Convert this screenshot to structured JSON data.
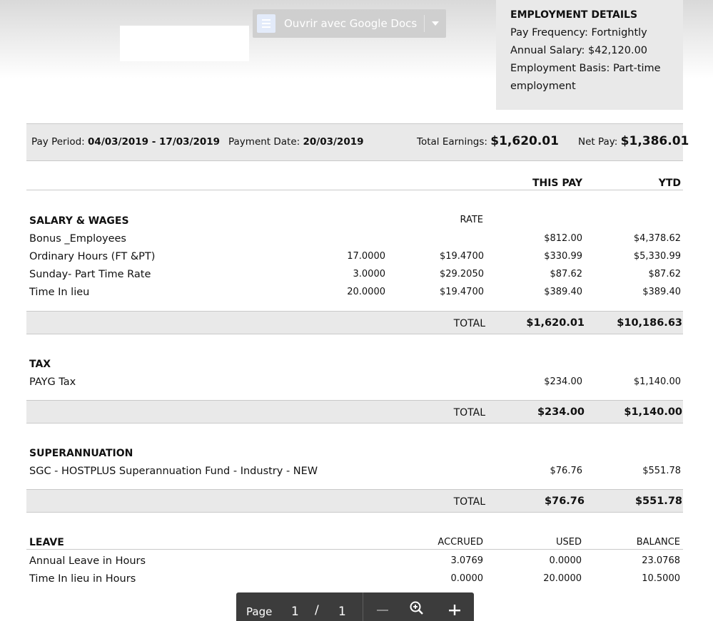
{
  "toolbar": {
    "open_with_label": "Ouvrir avec Google Docs"
  },
  "employment": {
    "heading": "EMPLOYMENT DETAILS",
    "pay_frequency": "Pay Frequency: Fortnightly",
    "annual_salary": "Annual Salary: $42,120.00",
    "basis_line1": "Employment Basis: Part-time",
    "basis_line2": "employment"
  },
  "summary": {
    "pay_period_label": "Pay Period: ",
    "pay_period_value": "04/03/2019 - 17/03/2019",
    "payment_date_label": "Payment Date: ",
    "payment_date_value": "20/03/2019",
    "total_earnings_label": "Total Earnings: ",
    "total_earnings_value": "$1,620.01",
    "net_pay_label": "Net Pay: ",
    "net_pay_value": "$1,386.01"
  },
  "columns": {
    "this_pay": "THIS PAY",
    "ytd": "YTD"
  },
  "salary": {
    "heading": "SALARY & WAGES",
    "rate_header": "RATE",
    "rows": [
      {
        "label": "Bonus _Employees",
        "hours": "",
        "rate": "",
        "this_pay": "$812.00",
        "ytd": "$4,378.62"
      },
      {
        "label": "Ordinary Hours (FT &PT)",
        "hours": "17.0000",
        "rate": "$19.4700",
        "this_pay": "$330.99",
        "ytd": "$5,330.99"
      },
      {
        "label": "Sunday- Part Time Rate",
        "hours": "3.0000",
        "rate": "$29.2050",
        "this_pay": "$87.62",
        "ytd": "$87.62"
      },
      {
        "label": "Time In lieu",
        "hours": "20.0000",
        "rate": "$19.4700",
        "this_pay": "$389.40",
        "ytd": "$389.40"
      }
    ],
    "total_label": "TOTAL",
    "total_this_pay": "$1,620.01",
    "total_ytd": "$10,186.63"
  },
  "tax": {
    "heading": "TAX",
    "rows": [
      {
        "label": "PAYG Tax",
        "this_pay": "$234.00",
        "ytd": "$1,140.00"
      }
    ],
    "total_label": "TOTAL",
    "total_this_pay": "$234.00",
    "total_ytd": "$1,140.00"
  },
  "super": {
    "heading": "SUPERANNUATION",
    "rows": [
      {
        "label": "SGC - HOSTPLUS Superannuation Fund - Industry - NEW",
        "this_pay": "$76.76",
        "ytd": "$551.78"
      }
    ],
    "total_label": "TOTAL",
    "total_this_pay": "$76.76",
    "total_ytd": "$551.78"
  },
  "leave": {
    "heading": "LEAVE",
    "accrued_header": "ACCRUED",
    "used_header": "USED",
    "balance_header": "BALANCE",
    "rows": [
      {
        "label": "Annual Leave in Hours",
        "accrued": "3.0769",
        "used": "0.0000",
        "balance": "23.0768"
      },
      {
        "label": "Time In lieu in Hours",
        "accrued": "0.0000",
        "used": "20.0000",
        "balance": "10.5000"
      }
    ]
  },
  "pager": {
    "page_label": "Page",
    "current": "1",
    "separator": "/",
    "total": "1"
  },
  "icons": {
    "docs": "google-docs-icon",
    "dropdown": "chevron-down-icon",
    "zoom_out": "minus-icon",
    "zoom_reset": "zoom-icon",
    "zoom_in": "plus-icon"
  }
}
